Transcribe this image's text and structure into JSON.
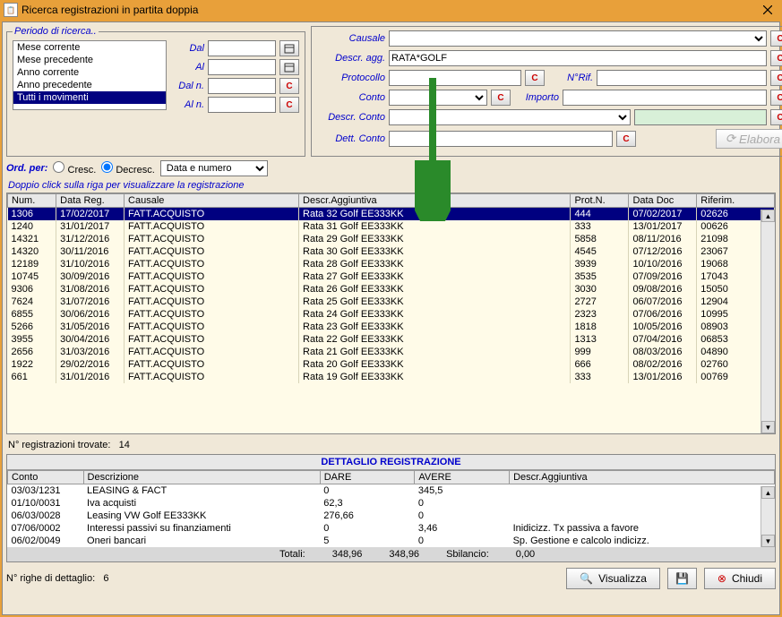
{
  "window": {
    "title": "Ricerca registrazioni in partita doppia"
  },
  "periodo": {
    "legend": "Periodo di ricerca..",
    "items": [
      "Mese corrente",
      "Mese precedente",
      "Anno corrente",
      "Anno precedente",
      "Tutti i movimenti"
    ],
    "selected_index": 4,
    "labels": {
      "dal": "Dal",
      "al": "Al",
      "daln": "Dal n.",
      "aln": "Al n.",
      "c": "C"
    }
  },
  "filter": {
    "labels": {
      "causale": "Causale",
      "descragg": "Descr. agg.",
      "protocollo": "Protocollo",
      "nrif": "N°Rif.",
      "conto": "Conto",
      "importo": "Importo",
      "descrconto": "Descr. Conto",
      "dettconto": "Dett. Conto",
      "c": "C",
      "elabora": "Elabora"
    },
    "values": {
      "descragg": "RATA*GOLF"
    }
  },
  "ordper": {
    "label": "Ord. per:",
    "cresc": "Cresc.",
    "decresc": "Decresc.",
    "field": "Data e numero"
  },
  "hint": "Doppio click sulla riga per visualizzare la registrazione",
  "grid1": {
    "headers": [
      "Num.",
      "Data Reg.",
      "Causale",
      "Descr.Aggiuntiva",
      "Prot.N.",
      "Data Doc",
      "Riferim."
    ],
    "rows": [
      [
        "1306",
        "17/02/2017",
        "FATT.ACQUISTO",
        "Rata 32 Golf EE333KK",
        "444",
        "07/02/2017",
        "02626"
      ],
      [
        "1240",
        "31/01/2017",
        "FATT.ACQUISTO",
        "Rata 31 Golf EE333KK",
        "333",
        "13/01/2017",
        "00626"
      ],
      [
        "14321",
        "31/12/2016",
        "FATT.ACQUISTO",
        "Rata 29 Golf EE333KK",
        "5858",
        "08/11/2016",
        "21098"
      ],
      [
        "14320",
        "30/11/2016",
        "FATT.ACQUISTO",
        "Rata 30 Golf EE333KK",
        "4545",
        "07/12/2016",
        "23067"
      ],
      [
        "12189",
        "31/10/2016",
        "FATT.ACQUISTO",
        "Rata 28 Golf EE333KK",
        "3939",
        "10/10/2016",
        "19068"
      ],
      [
        "10745",
        "30/09/2016",
        "FATT.ACQUISTO",
        "Rata 27 Golf EE333KK",
        "3535",
        "07/09/2016",
        "17043"
      ],
      [
        "9306",
        "31/08/2016",
        "FATT.ACQUISTO",
        "Rata 26 Golf EE333KK",
        "3030",
        "09/08/2016",
        "15050"
      ],
      [
        "7624",
        "31/07/2016",
        "FATT.ACQUISTO",
        "Rata 25 Golf EE333KK",
        "2727",
        "06/07/2016",
        "12904"
      ],
      [
        "6855",
        "30/06/2016",
        "FATT.ACQUISTO",
        "Rata 24 Golf EE333KK",
        "2323",
        "07/06/2016",
        "10995"
      ],
      [
        "5266",
        "31/05/2016",
        "FATT.ACQUISTO",
        "Rata 23 Golf EE333KK",
        "1818",
        "10/05/2016",
        "08903"
      ],
      [
        "3955",
        "30/04/2016",
        "FATT.ACQUISTO",
        "Rata 22 Golf EE333KK",
        "1313",
        "07/04/2016",
        "06853"
      ],
      [
        "2656",
        "31/03/2016",
        "FATT.ACQUISTO",
        "Rata 21 Golf EE333KK",
        "999",
        "08/03/2016",
        "04890"
      ],
      [
        "1922",
        "29/02/2016",
        "FATT.ACQUISTO",
        "Rata 20 Golf EE333KK",
        "666",
        "08/02/2016",
        "02760"
      ],
      [
        "661",
        "31/01/2016",
        "FATT.ACQUISTO",
        "Rata 19 Golf EE333KK",
        "333",
        "13/01/2016",
        "00769"
      ]
    ],
    "selected_index": 0
  },
  "count": {
    "label": "N° registrazioni trovate:",
    "value": "14"
  },
  "detail": {
    "title": "DETTAGLIO REGISTRAZIONE",
    "headers": [
      "Conto",
      "Descrizione",
      "DARE",
      "AVERE",
      "Descr.Aggiuntiva"
    ],
    "rows": [
      [
        "03/03/1231",
        "LEASING & FACT",
        "0",
        "345,5",
        ""
      ],
      [
        "01/10/0031",
        "Iva acquisti",
        "62,3",
        "0",
        ""
      ],
      [
        "06/03/0028",
        "Leasing VW Golf  EE333KK",
        "276,66",
        "0",
        ""
      ],
      [
        "07/06/0002",
        "Interessi passivi su finanziamenti",
        "0",
        "3,46",
        "Inidicizz. Tx passiva a favore"
      ],
      [
        "06/02/0049",
        "Oneri bancari",
        "5",
        "0",
        "Sp. Gestione e calcolo indicizz."
      ]
    ],
    "totals": {
      "label": "Totali:",
      "dare": "348,96",
      "avere": "348,96",
      "sbil_label": "Sbilancio:",
      "sbil": "0,00"
    }
  },
  "righe": {
    "label": "N° righe di dettaglio:",
    "value": "6"
  },
  "buttons": {
    "visualizza": "Visualizza",
    "chiudi": "Chiudi"
  }
}
